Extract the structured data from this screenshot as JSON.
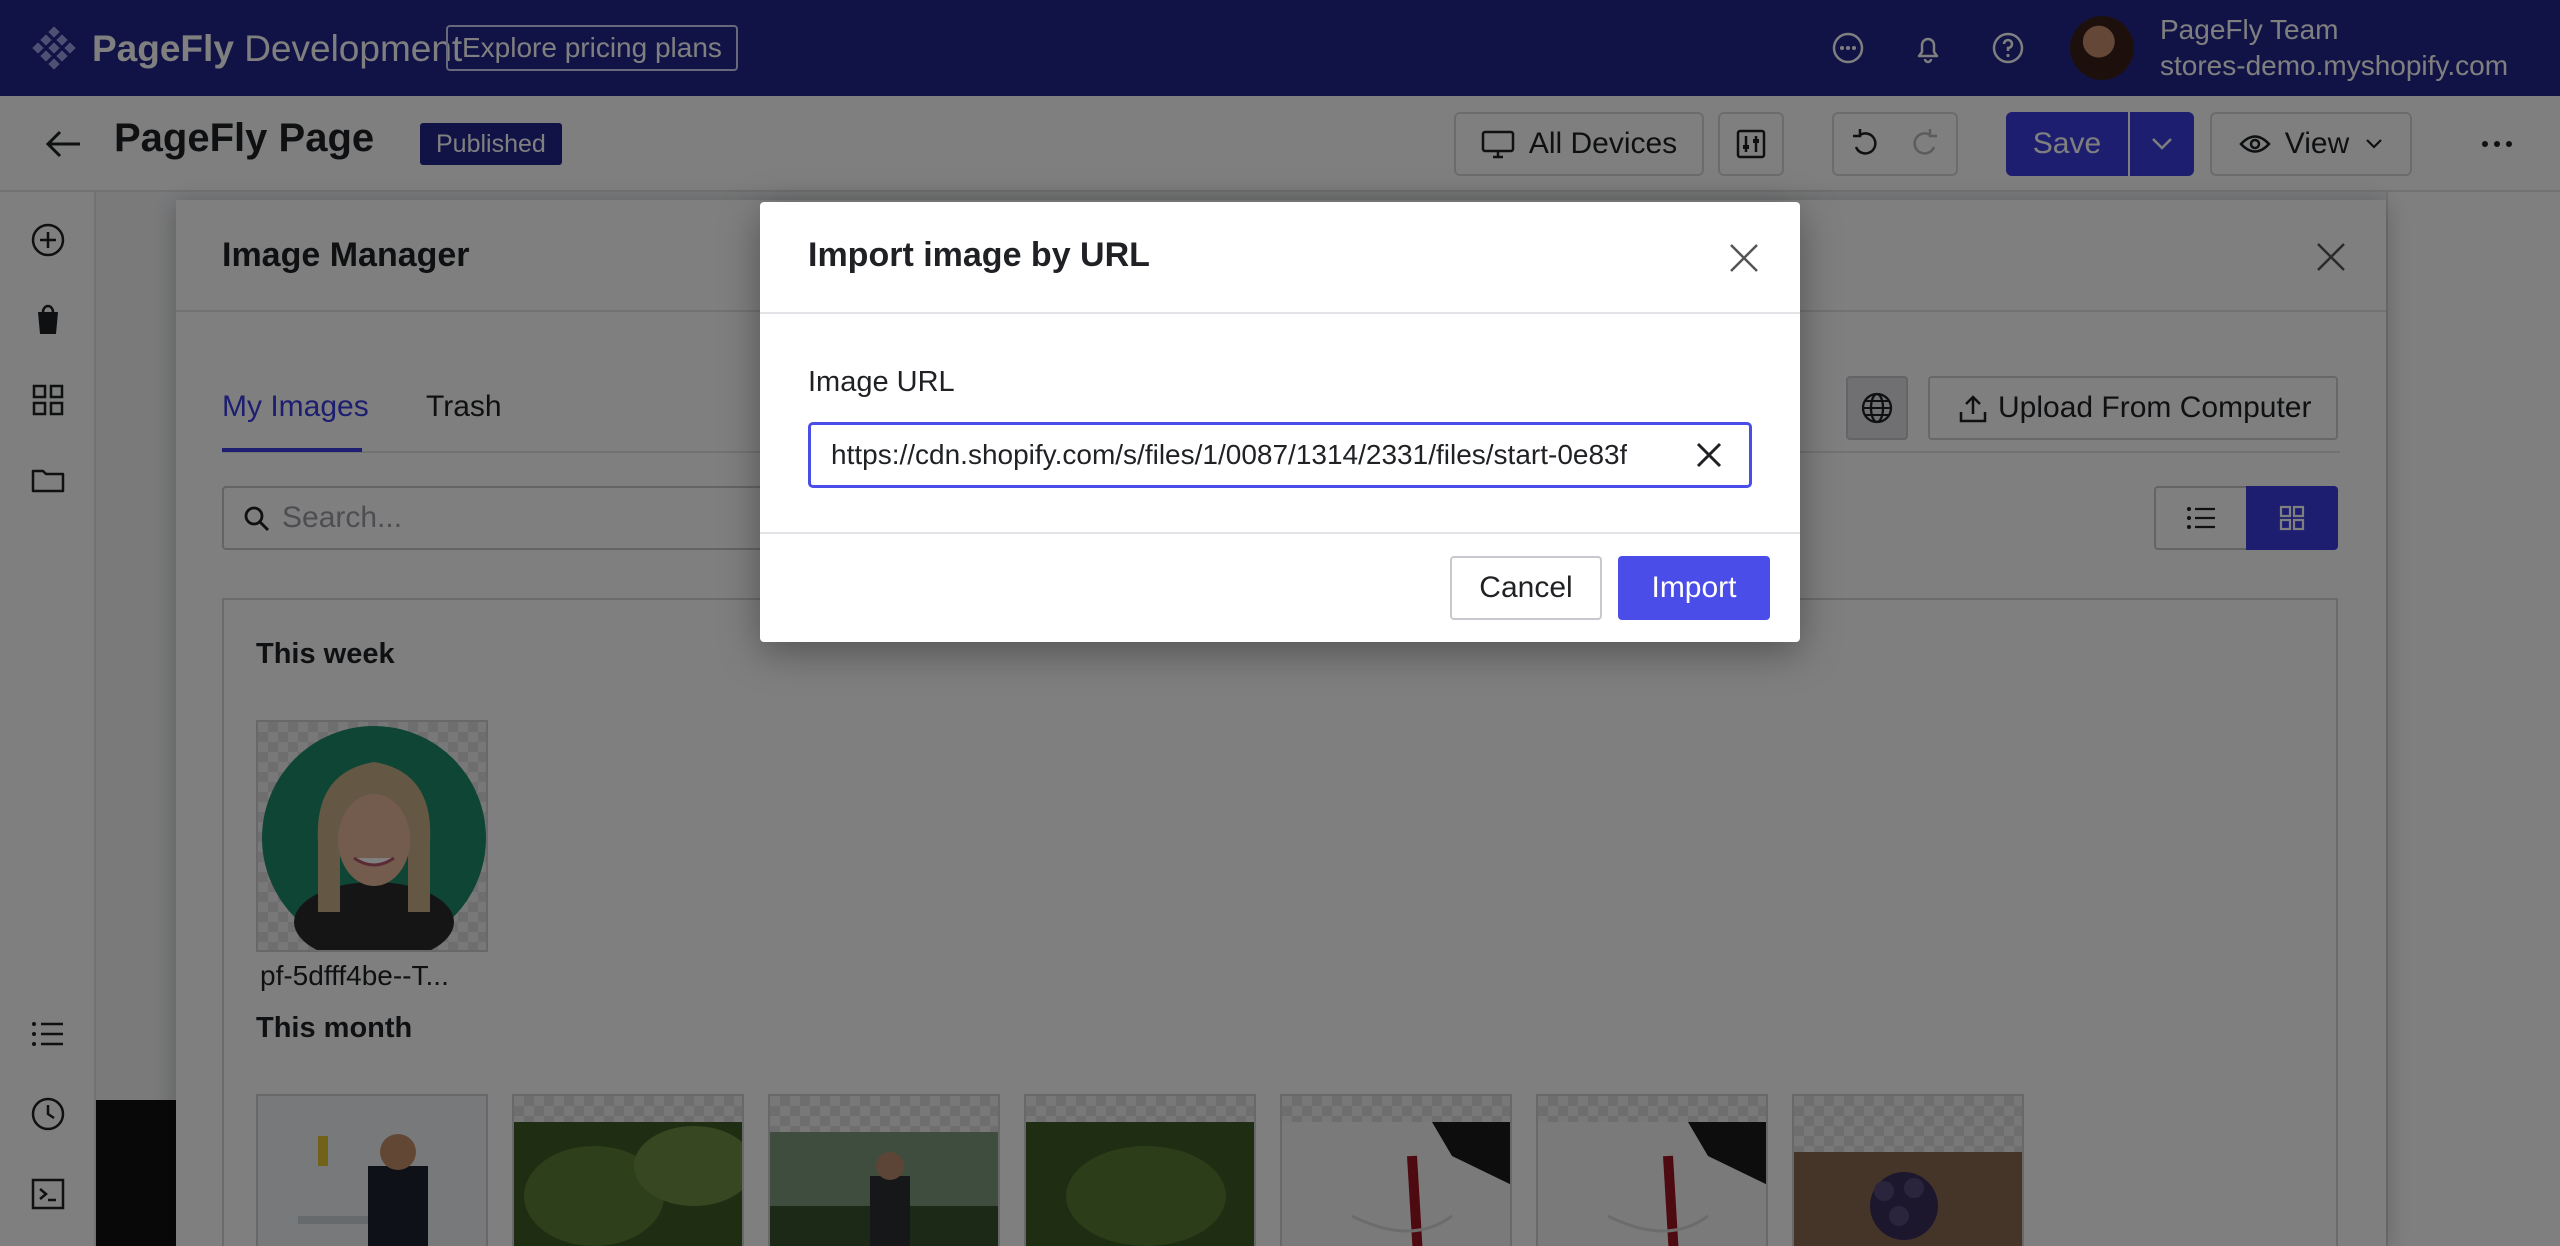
{
  "topbar": {
    "brand_name": "PageFly",
    "brand_suffix": "Development",
    "pricing_label": "Explore pricing plans",
    "account_name": "PageFly Team",
    "account_store": "stores-demo.myshopify.com"
  },
  "header": {
    "page_title": "PageFly Page",
    "status_badge": "Published",
    "devices_label": "All Devices",
    "save_label": "Save",
    "view_label": "View"
  },
  "image_manager": {
    "title": "Image Manager",
    "tabs": [
      {
        "label": "My Images",
        "active": true
      },
      {
        "label": "Trash",
        "active": false
      }
    ],
    "upload_label": "Upload From Computer",
    "search_placeholder": "Search...",
    "sections": [
      {
        "title": "This week",
        "items": [
          "pf-5dfff4be--T..."
        ]
      },
      {
        "title": "This month"
      }
    ]
  },
  "dialog": {
    "title": "Import image by URL",
    "field_label": "Image URL",
    "field_value": "https://cdn.shopify.com/s/files/1/0087/1314/2331/files/start-0e83f",
    "cancel_label": "Cancel",
    "import_label": "Import"
  },
  "colors": {
    "brand": "#23268f",
    "accent": "#4a4de8"
  }
}
